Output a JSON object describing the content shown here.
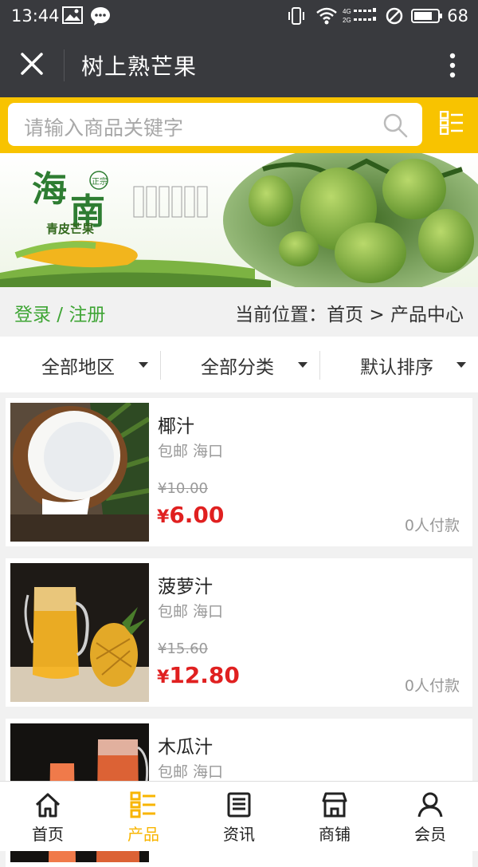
{
  "status": {
    "time": "13:44",
    "battery": "68"
  },
  "titlebar": {
    "title": "树上熟芒果"
  },
  "search": {
    "placeholder": "请输入商品关键字"
  },
  "banner": {
    "brand_a": "海",
    "brand_b": "南",
    "brand_tag": "正宗",
    "brand_sub": "青皮芒果"
  },
  "nav": {
    "login": "登录 / 注册",
    "crumb_prefix": "当前位置：",
    "crumb_home": "首页",
    "crumb_sep": " > ",
    "crumb_current": "产品中心"
  },
  "filters": [
    {
      "label": "全部地区"
    },
    {
      "label": "全部分类"
    },
    {
      "label": "默认排序"
    }
  ],
  "products": [
    {
      "name": "椰汁",
      "shipping": "包邮 海口",
      "original_price": "¥10.00",
      "currency": "¥",
      "price": "6.00",
      "sold": "0人付款"
    },
    {
      "name": "菠萝汁",
      "shipping": "包邮 海口",
      "original_price": "¥15.60",
      "currency": "¥",
      "price": "12.80",
      "sold": "0人付款"
    },
    {
      "name": "木瓜汁",
      "shipping": "包邮 海口"
    }
  ],
  "tabs": [
    {
      "label": "首页",
      "icon": "home-icon"
    },
    {
      "label": "产品",
      "icon": "product-list-icon"
    },
    {
      "label": "资讯",
      "icon": "news-icon"
    },
    {
      "label": "商铺",
      "icon": "store-icon"
    },
    {
      "label": "会员",
      "icon": "member-icon"
    }
  ],
  "colors": {
    "accent": "#f8c300",
    "price": "#e02020",
    "login": "#3fa535",
    "header": "#393a3e"
  }
}
